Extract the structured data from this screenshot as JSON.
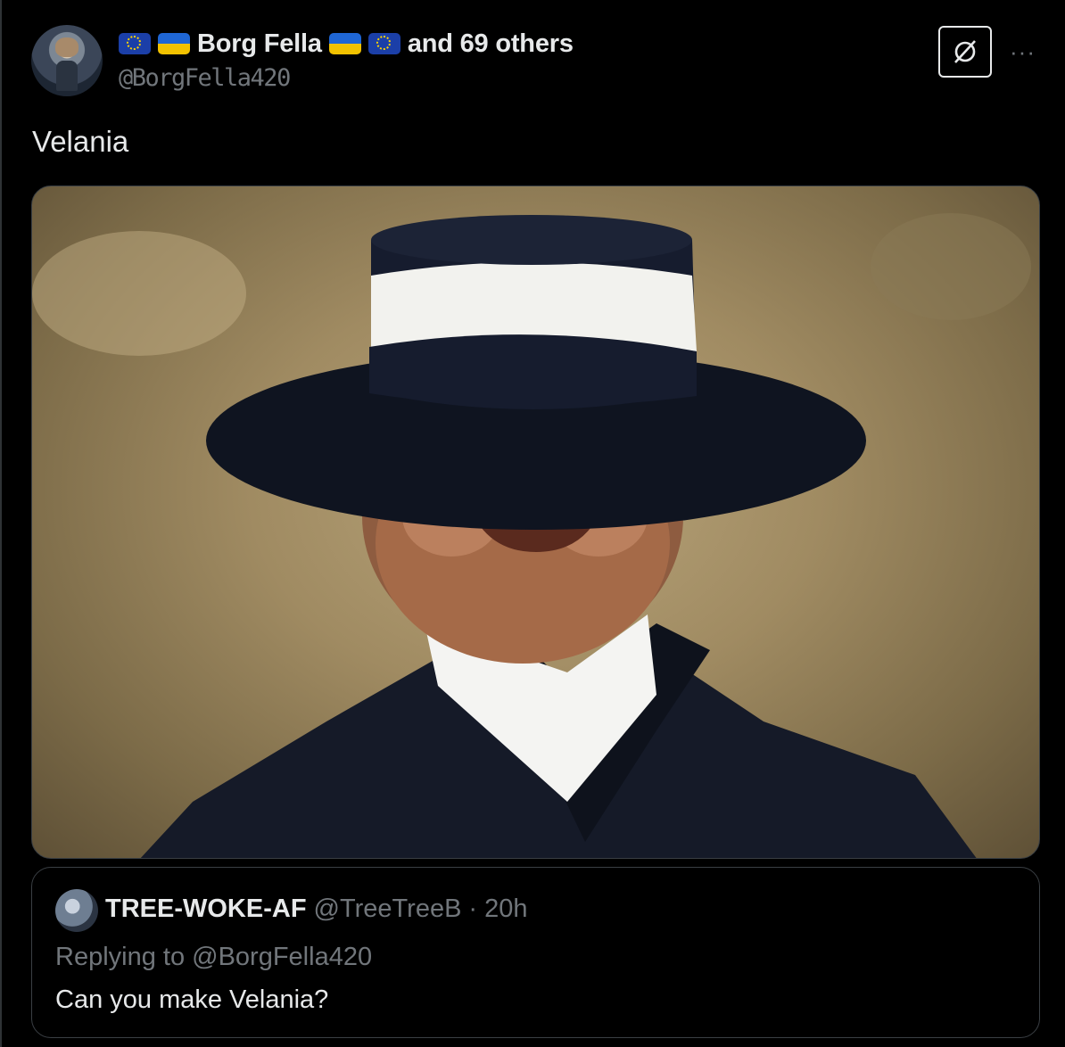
{
  "post": {
    "display_name": "Borg Fella",
    "others": "and 69 others",
    "handle": "@BorgFella420",
    "text": "Velania",
    "flags_before": [
      "eu-flag",
      "ukraine-flag"
    ],
    "flags_after": [
      "ukraine-flag",
      "eu-flag"
    ],
    "more_label": "···"
  },
  "quoted": {
    "display_name": "TREE-WOKE-AF",
    "handle": "@TreeTreeB",
    "separator": "·",
    "time": "20h",
    "replying_to": "Replying to @BorgFella420",
    "text": "Can you make Velania?"
  },
  "colors": {
    "background": "#000000",
    "text_primary": "#e7e9ea",
    "text_secondary": "#71767b",
    "border": "#3a3f44"
  }
}
